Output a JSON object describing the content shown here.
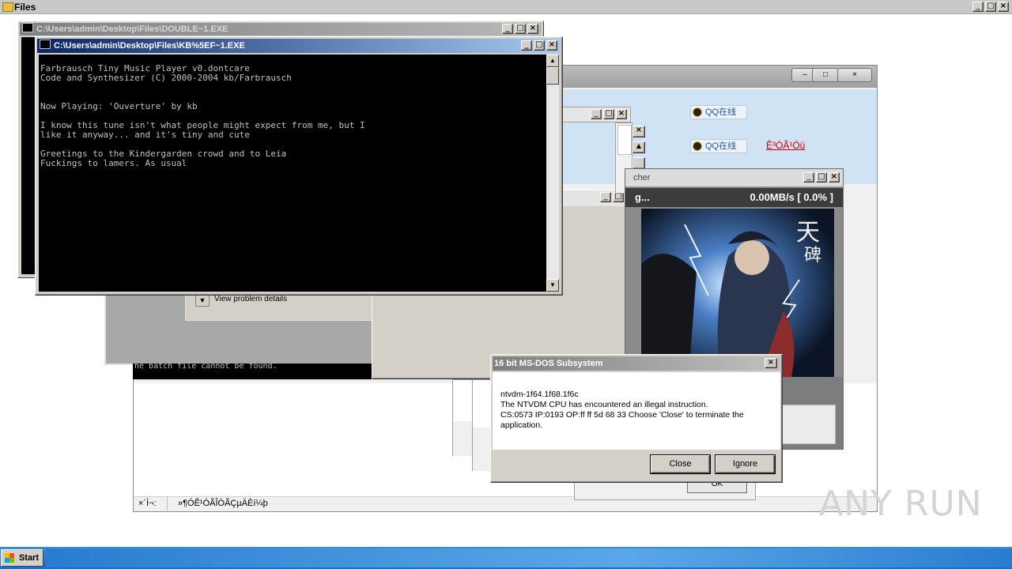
{
  "files_window": {
    "title": "Files"
  },
  "console_back": {
    "title": "C:\\Users\\admin\\Desktop\\Files\\DOUBLE~1.EXE"
  },
  "console_front": {
    "title": "C:\\Users\\admin\\Desktop\\Files\\KB%5EF~1.EXE",
    "lines": [
      "Farbrausch Tiny Music Player v0.dontcare",
      "Code and Synthesizer (C) 2000-2004 kb/Farbrausch",
      "",
      "",
      "Now Playing: 'Ouverture' by kb",
      "",
      "I know this tune isn't what people might expect from me, but I",
      "like it anyway... and it's tiny and cute",
      "",
      "Greetings to the Kindergarden crowd and to Leia",
      "Fuckings to lamers. As usual"
    ]
  },
  "chs_window": {
    "qq_button_1": "QQ在线",
    "qq_button_2": "QQ在线",
    "link": "Ê³ÓÃ¹Óü",
    "status_left": "×´Ì¬:",
    "status_right": "»¶Ó­Ê¹ÓÃÎÒÃÇµÄÈí¼þ"
  },
  "problem_window": {
    "details_label": "View problem details"
  },
  "console_strip": {
    "text": "he batch file cannot be found."
  },
  "launcher": {
    "title_fragment": "cher",
    "status_fragment": "g...",
    "speed": "0.00MB/s [ 0.0% ]"
  },
  "white_dialog": {
    "ok_label": "OK"
  },
  "ntvdm_dialog": {
    "title": "16 bit MS-DOS Subsystem",
    "line1": "ntvdm-1f64.1f68.1f6c",
    "line2": "The NTVDM CPU has encountered an illegal instruction.",
    "line3": "CS:0573 IP:0193 OP:ff ff 5d 68 33 Choose 'Close' to terminate the",
    "line4": "application.",
    "close_label": "Close",
    "ignore_label": "Ignore"
  },
  "watermark": {
    "text": "ANY RUN"
  },
  "taskbar": {
    "start_label": "Start"
  },
  "colors": {
    "title_active": "#0a246a",
    "desktop_bg": "#ffffff",
    "taskbar": "#1e6cc0"
  }
}
